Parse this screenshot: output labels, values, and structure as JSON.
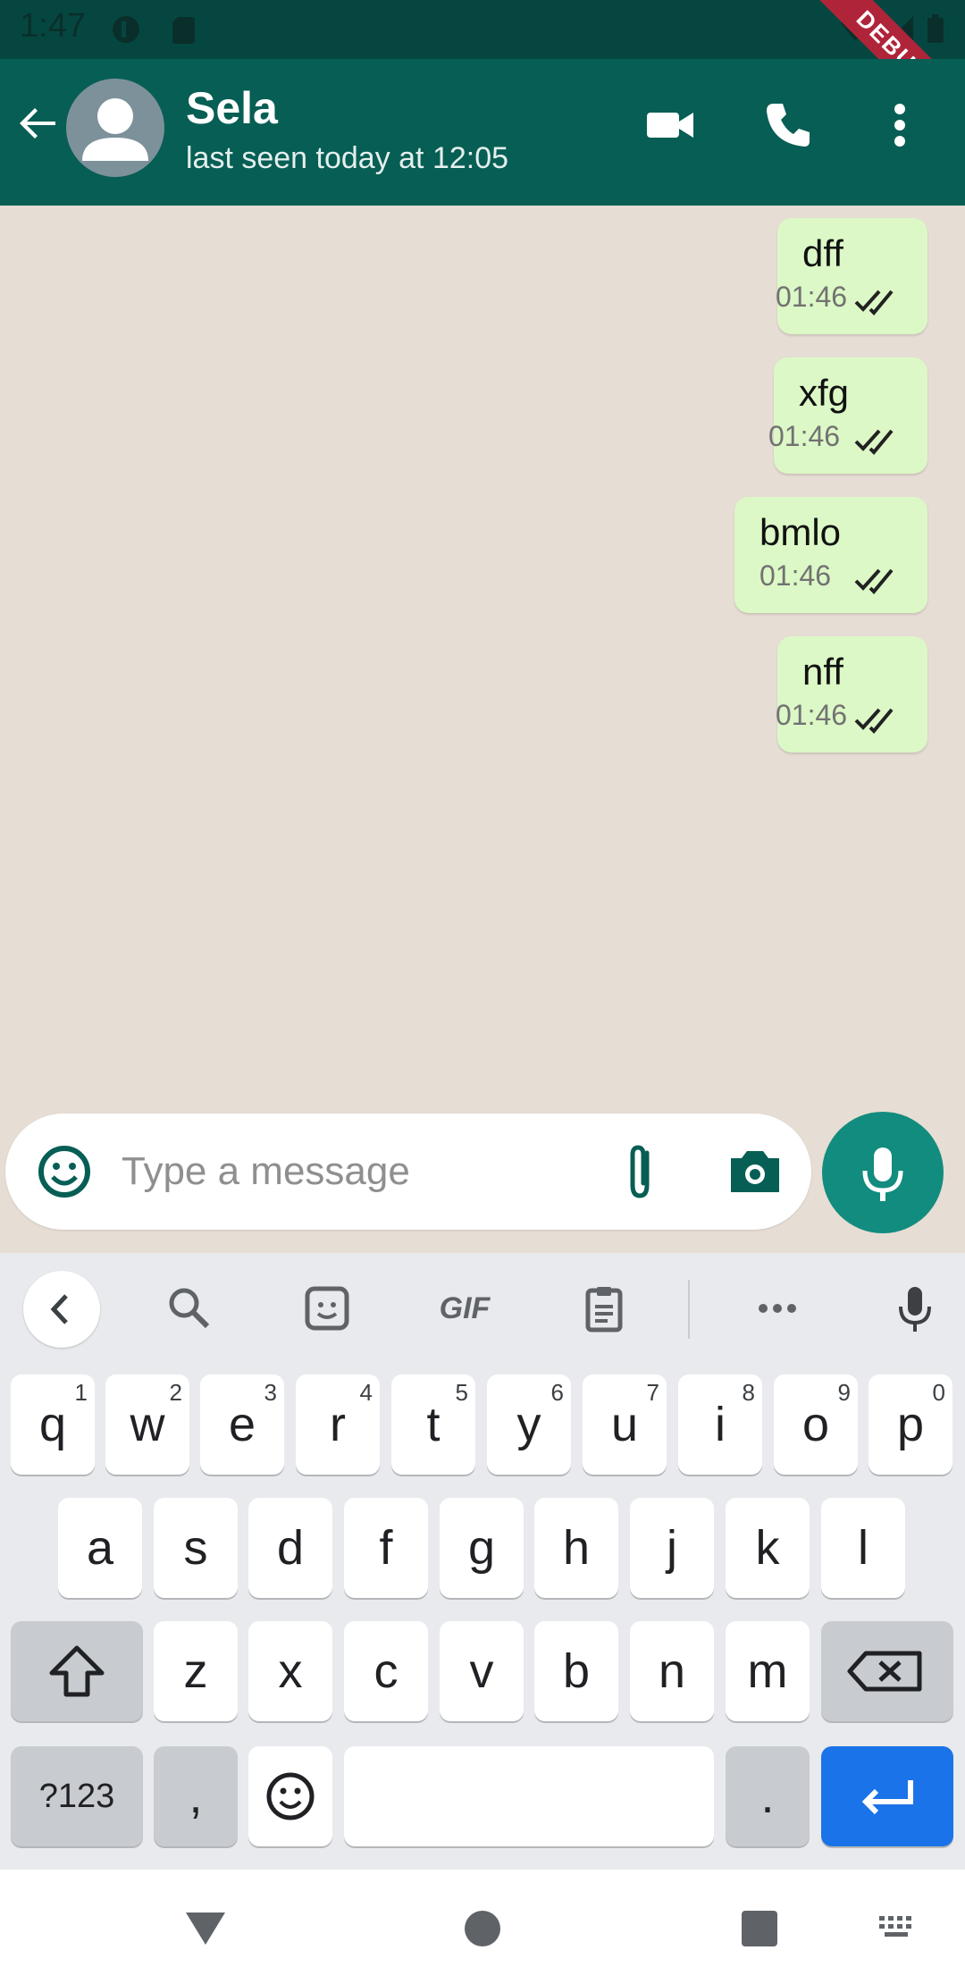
{
  "status_bar": {
    "time": "1:47",
    "debug_label": "DEBUG"
  },
  "header": {
    "contact_name": "Sela",
    "contact_status": "last seen today at 12:05"
  },
  "messages": [
    {
      "text": "dff",
      "time": "01:46",
      "status": "read"
    },
    {
      "text": "xfg",
      "time": "01:46",
      "status": "read"
    },
    {
      "text": "bmlo",
      "time": "01:46",
      "status": "read"
    },
    {
      "text": "nff",
      "time": "01:46",
      "status": "read"
    }
  ],
  "composer": {
    "placeholder": "Type a message"
  },
  "keyboard": {
    "toolbar": {
      "gif_label": "GIF"
    },
    "row1": [
      {
        "key": "q",
        "hint": "1"
      },
      {
        "key": "w",
        "hint": "2"
      },
      {
        "key": "e",
        "hint": "3"
      },
      {
        "key": "r",
        "hint": "4"
      },
      {
        "key": "t",
        "hint": "5"
      },
      {
        "key": "y",
        "hint": "6"
      },
      {
        "key": "u",
        "hint": "7"
      },
      {
        "key": "i",
        "hint": "8"
      },
      {
        "key": "o",
        "hint": "9"
      },
      {
        "key": "p",
        "hint": "0"
      }
    ],
    "row2": [
      "a",
      "s",
      "d",
      "f",
      "g",
      "h",
      "j",
      "k",
      "l"
    ],
    "row3": [
      "z",
      "x",
      "c",
      "v",
      "b",
      "n",
      "m"
    ],
    "row4": {
      "symbols": "?123",
      "comma": ",",
      "period": "."
    }
  },
  "colors": {
    "app_bar": "#075e54",
    "status_bar": "#054740",
    "outgoing_bubble": "#dcf8c6",
    "accent": "#128c7e",
    "enter_key": "#1a73e8"
  }
}
